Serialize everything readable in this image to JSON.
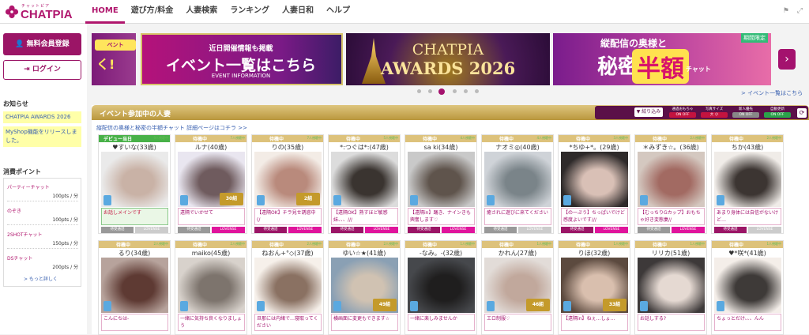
{
  "header": {
    "logo_sub": "チャットピア",
    "logo_name": "CHATPIA",
    "nav": [
      "HOME",
      "遊び方/料金",
      "人妻検索",
      "ランキング",
      "人妻日和",
      "ヘルプ"
    ]
  },
  "sidebar": {
    "register_label": "無料会員登録",
    "login_label": "ログイン",
    "news_heading": "お知らせ",
    "news": [
      "CHATPIA AWARDS 2026",
      "MyShop機能をリリースしました。"
    ],
    "points_heading": "消費ポイント",
    "points": [
      {
        "name": "パーティーチャット",
        "value": "100pts / 分"
      },
      {
        "name": "のぞき",
        "value": "100pts / 分"
      },
      {
        "name": "2SHOTチャット",
        "value": "150pts / 分"
      },
      {
        "name": "DSチャット",
        "value": "200pts / 分"
      }
    ],
    "more_label": "> もっと詳しく"
  },
  "carousel": {
    "b1_tag": "ベント",
    "b1_text": "く!",
    "b2_line1": "近日開催情報も掲載",
    "b2_line2": "イベント一覧はこちら",
    "b2_line3": "EVENT INFORMATION",
    "b3_line1": "CHATPIA",
    "b3_line2": "AWARDS 2026",
    "b4_badge": "期間限定",
    "b4_line1": "縦配信の奥様と",
    "b4_line2": "秘密の",
    "b4_half": "半額",
    "b4_chat": "チャット",
    "prev": "‹",
    "next": "›",
    "event_link": "> イベント一覧はこちら",
    "dot_count": 6,
    "active_dot": 2
  },
  "event": {
    "title": "イベント参加中の人妻",
    "note": "縦配信の奥様と秘密の半額チャット 詳細ページはコチラ >>",
    "filter_label": "絞り込み",
    "controls": [
      {
        "label": "通過おもちゃ",
        "value": "ON OFF",
        "style": "red"
      },
      {
        "label": "写真サイズ",
        "value": "大 小",
        "style": "red"
      },
      {
        "label": "新人優先",
        "value": "ON OFF",
        "style": "gray"
      },
      {
        "label": "自動更新",
        "value": "ON OFF",
        "style": "on"
      }
    ],
    "refresh": "⟳"
  },
  "cards": [
    {
      "status": "デビュー当日",
      "watch": "9人視聴中",
      "name": "♥すいな(33歳)",
      "comment": "お話しメインです",
      "tag_left": "待受通話",
      "tag_right": "LOVENSE",
      "debut": true,
      "ribbon": "",
      "left_on": false,
      "right_on": false
    },
    {
      "status": "待機中",
      "watch": "7人視聴中",
      "name": "ルナ(40歳)",
      "comment": "遠隔でいかせて",
      "tag_left": "待受通話",
      "tag_right": "LOVENSE",
      "ribbon": "30組",
      "left_on": false,
      "right_on": true
    },
    {
      "status": "待機中",
      "watch": "7人視聴中",
      "name": "りの(35歳)",
      "comment": "【遠隔OK】チラ見せ誘惑中(/",
      "tag_left": "待受通話",
      "tag_right": "LOVENSE",
      "ribbon": "2組",
      "left_on": true,
      "right_on": true
    },
    {
      "status": "待機中",
      "watch": "5人視聴中",
      "name": "*:つぐは*:(47歳)",
      "comment": "【遠隔OK】熟すほど敏感妹、、、///",
      "tag_left": "待受通話",
      "tag_right": "LOVENSE",
      "ribbon": "",
      "left_on": true,
      "right_on": true
    },
    {
      "status": "待機中",
      "watch": "4人視聴中",
      "name": "sa ki(34歳)",
      "comment": "【遠隔in】踊き、ナインきも興奮します♡",
      "tag_left": "待受通話",
      "tag_right": "LOVENSE",
      "ribbon": "",
      "left_on": true,
      "right_on": true
    },
    {
      "status": "待機中",
      "watch": "4人視聴中",
      "name": "ナオミ◎(40歳)",
      "comment": "癒されに遊びに来てください",
      "tag_left": "待受通話",
      "tag_right": "LOVENSE",
      "ribbon": "",
      "left_on": false,
      "right_on": false
    },
    {
      "status": "待機中",
      "watch": "3人視聴中",
      "name": "*ちゆ+*。(29歳)",
      "comment": "【の一ぷう】ちっぱいでけど感度よいです///",
      "tag_left": "待受通話",
      "tag_right": "LOVENSE",
      "ribbon": "",
      "left_on": true,
      "right_on": true
    },
    {
      "status": "待機中",
      "watch": "2人視聴中",
      "name": "＊みずき☆。(36歳)",
      "comment": "【むっちりGカップ】おもちゃ好き変態妻//",
      "tag_left": "待受通話",
      "tag_right": "LOVENSE",
      "ribbon": "",
      "left_on": false,
      "right_on": true
    },
    {
      "status": "待機中",
      "watch": "2人視聴中",
      "name": "ちか(43歳)",
      "comment": "あまり身体には自信がないけど…",
      "tag_left": "待受通話",
      "tag_right": "LOVENSE",
      "ribbon": "",
      "left_on": true,
      "right_on": false
    },
    {
      "status": "待機中",
      "watch": "2人視聴中",
      "name": "るり(34歳)",
      "comment": "こんにちは-",
      "tag_left": "",
      "tag_right": "",
      "ribbon": "",
      "left_on": false,
      "right_on": false
    },
    {
      "status": "待機中",
      "watch": "2人視聴中",
      "name": "maiko(45歳)",
      "comment": "一緒に気持ち良くなりましょう",
      "tag_left": "",
      "tag_right": "",
      "ribbon": "",
      "left_on": false,
      "right_on": false
    },
    {
      "status": "待機中",
      "watch": "2人視聴中",
      "name": "ねおん+°◇(37歳)",
      "comment": "旦那には内緒で…寝取ってください",
      "tag_left": "",
      "tag_right": "",
      "ribbon": "",
      "left_on": false,
      "right_on": false
    },
    {
      "status": "待機中",
      "watch": "2人視聴中",
      "name": "ゆい☆★(41歳)",
      "comment": "横画面に変更もできます☆",
      "tag_left": "",
      "tag_right": "",
      "ribbon": "49組",
      "left_on": false,
      "right_on": false
    },
    {
      "status": "待機中",
      "watch": "1人視聴中",
      "name": "-なみ。-(32歳)",
      "comment": "一緒に楽しみませんか",
      "tag_left": "",
      "tag_right": "",
      "ribbon": "",
      "left_on": false,
      "right_on": false
    },
    {
      "status": "待機中",
      "watch": "1人視聴中",
      "name": "かれん(27歳)",
      "comment": "エロ制服♡",
      "tag_left": "",
      "tag_right": "",
      "ribbon": "46組",
      "left_on": false,
      "right_on": false
    },
    {
      "status": "待機中",
      "watch": "1人視聴中",
      "name": "りほ(32歳)",
      "comment": "【遠隔in】ねぇ…しょ…",
      "tag_left": "",
      "tag_right": "",
      "ribbon": "33組",
      "left_on": false,
      "right_on": false
    },
    {
      "status": "待機中",
      "watch": "1人視聴中",
      "name": "リリカ(51歳)",
      "comment": "お話しする?",
      "tag_left": "",
      "tag_right": "",
      "ribbon": "",
      "left_on": false,
      "right_on": false
    },
    {
      "status": "待機中",
      "watch": "1人視聴中",
      "name": "♥*咲*(41歳)",
      "comment": "ちょっとだけ、、、んん",
      "tag_left": "",
      "tag_right": "",
      "ribbon": "",
      "left_on": false,
      "right_on": false
    }
  ]
}
